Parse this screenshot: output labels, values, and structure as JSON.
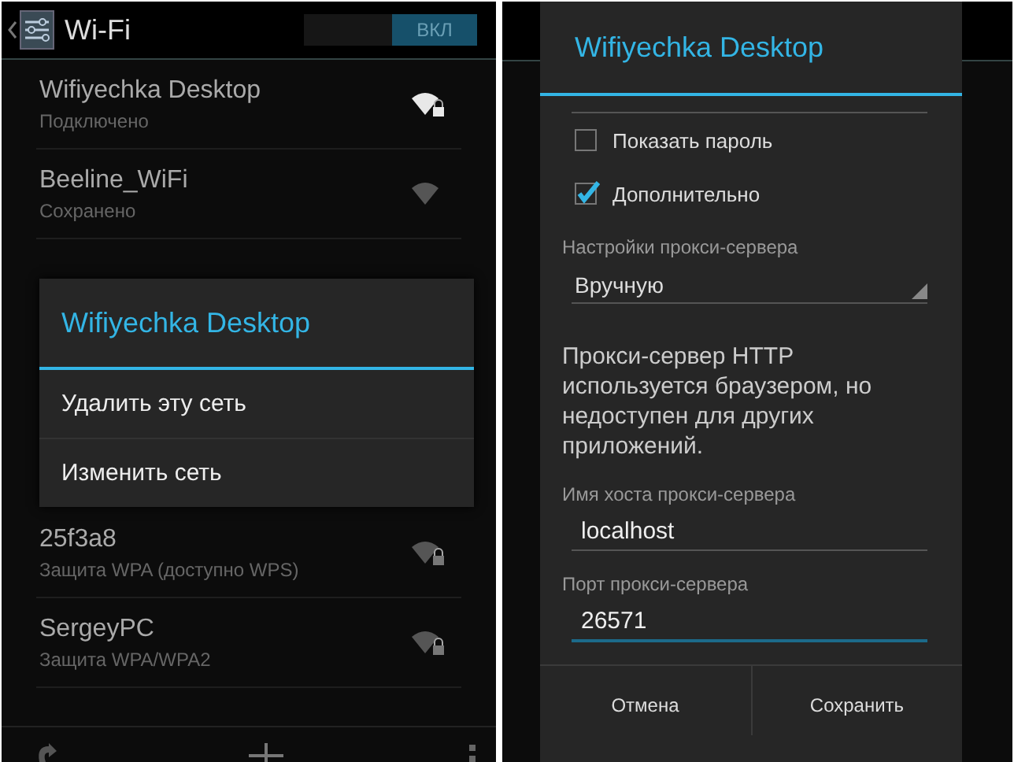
{
  "left_screen": {
    "action_bar": {
      "title": "Wi-Fi",
      "switch": {
        "label": "ВКЛ",
        "on": true
      }
    },
    "networks": [
      {
        "name": "Wifiyechka Desktop",
        "status": "Подключено",
        "connected": true,
        "secured": true
      },
      {
        "name": "Beeline_WiFi",
        "status": "Сохранено",
        "connected": false,
        "secured": false
      },
      {
        "name": "25f3a8",
        "status": "Защита WPA (доступно WPS)",
        "connected": false,
        "secured": true
      },
      {
        "name": "SergeyPC",
        "status": "Защита WPA/WPA2",
        "connected": false,
        "secured": true
      }
    ],
    "context_menu": {
      "title": "Wifiyechka Desktop",
      "items": [
        "Удалить эту сеть",
        "Изменить сеть"
      ]
    }
  },
  "right_screen": {
    "dialog": {
      "title": "Wifiyechka Desktop",
      "checkboxes": [
        {
          "label": "Показать пароль",
          "checked": false
        },
        {
          "label": "Дополнительно",
          "checked": true
        }
      ],
      "proxy_label": "Настройки прокси-сервера",
      "proxy_value": "Вручную",
      "proxy_note": "Прокси-сервер HTTP используется браузером, но недоступен для других приложений.",
      "fields": [
        {
          "label": "Имя хоста прокси-сервера",
          "value": "localhost",
          "focused": false
        },
        {
          "label": "Порт прокси-сервера",
          "value": "26571",
          "focused": true
        }
      ],
      "buttons": [
        "Отмена",
        "Сохранить"
      ]
    }
  }
}
